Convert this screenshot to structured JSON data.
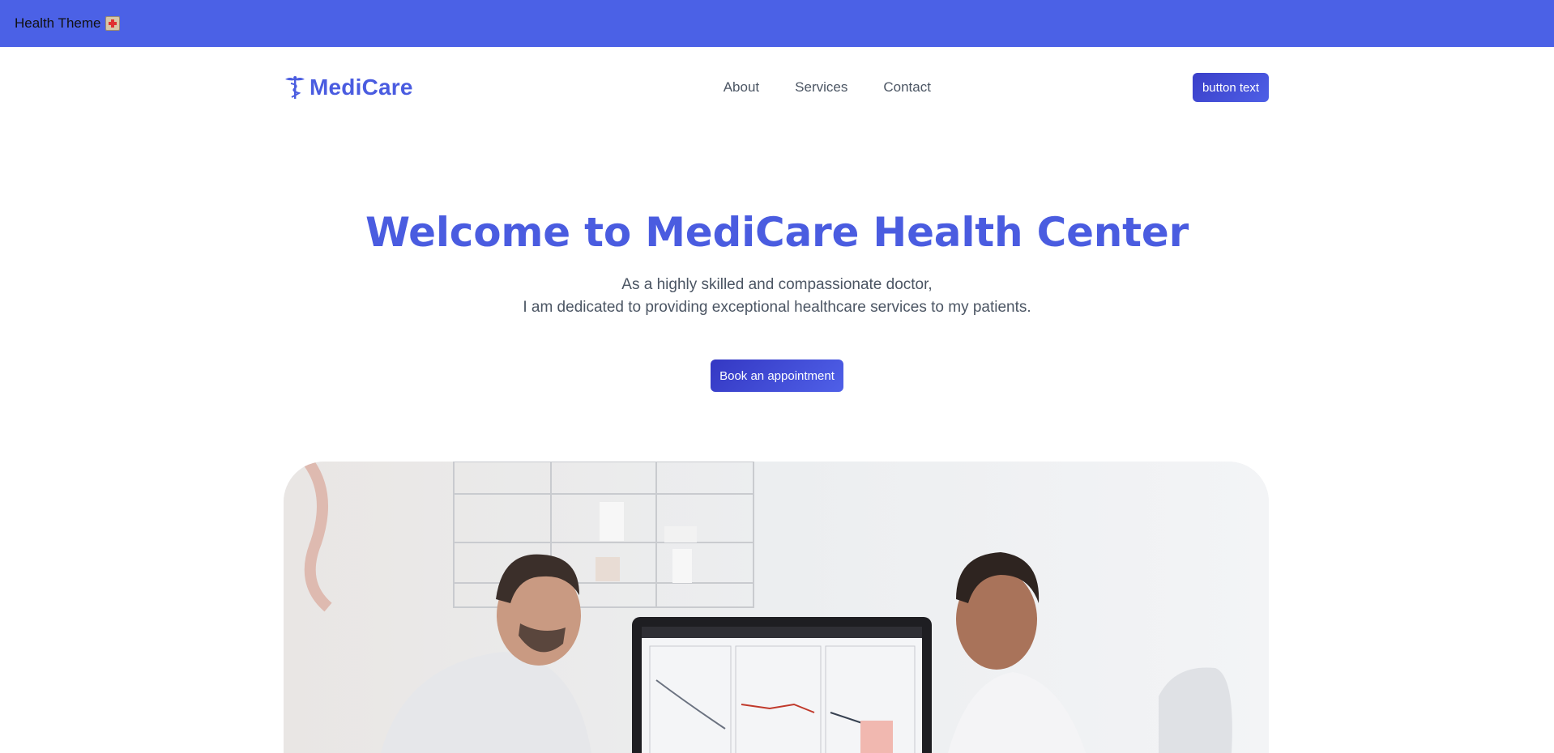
{
  "topbar": {
    "title": "Health Theme",
    "emoji_icon": "hospital-emoji-icon"
  },
  "brand": {
    "name": "MediCare",
    "logo_icon": "caduceus-icon",
    "color": "#4a5ce0"
  },
  "nav": {
    "links": [
      "About",
      "Services",
      "Contact"
    ],
    "button_label": "button text"
  },
  "hero": {
    "title": "Welcome to MediCare Health Center",
    "subtitle_line1": "As a highly skilled and compassionate doctor,",
    "subtitle_line2": "I am dedicated to providing exceptional healthcare services to my patients.",
    "cta_label": "Book an appointment"
  },
  "colors": {
    "topbar": "#4b61e6",
    "accent": "#4a5ce0",
    "button": "#3a3fc9"
  }
}
